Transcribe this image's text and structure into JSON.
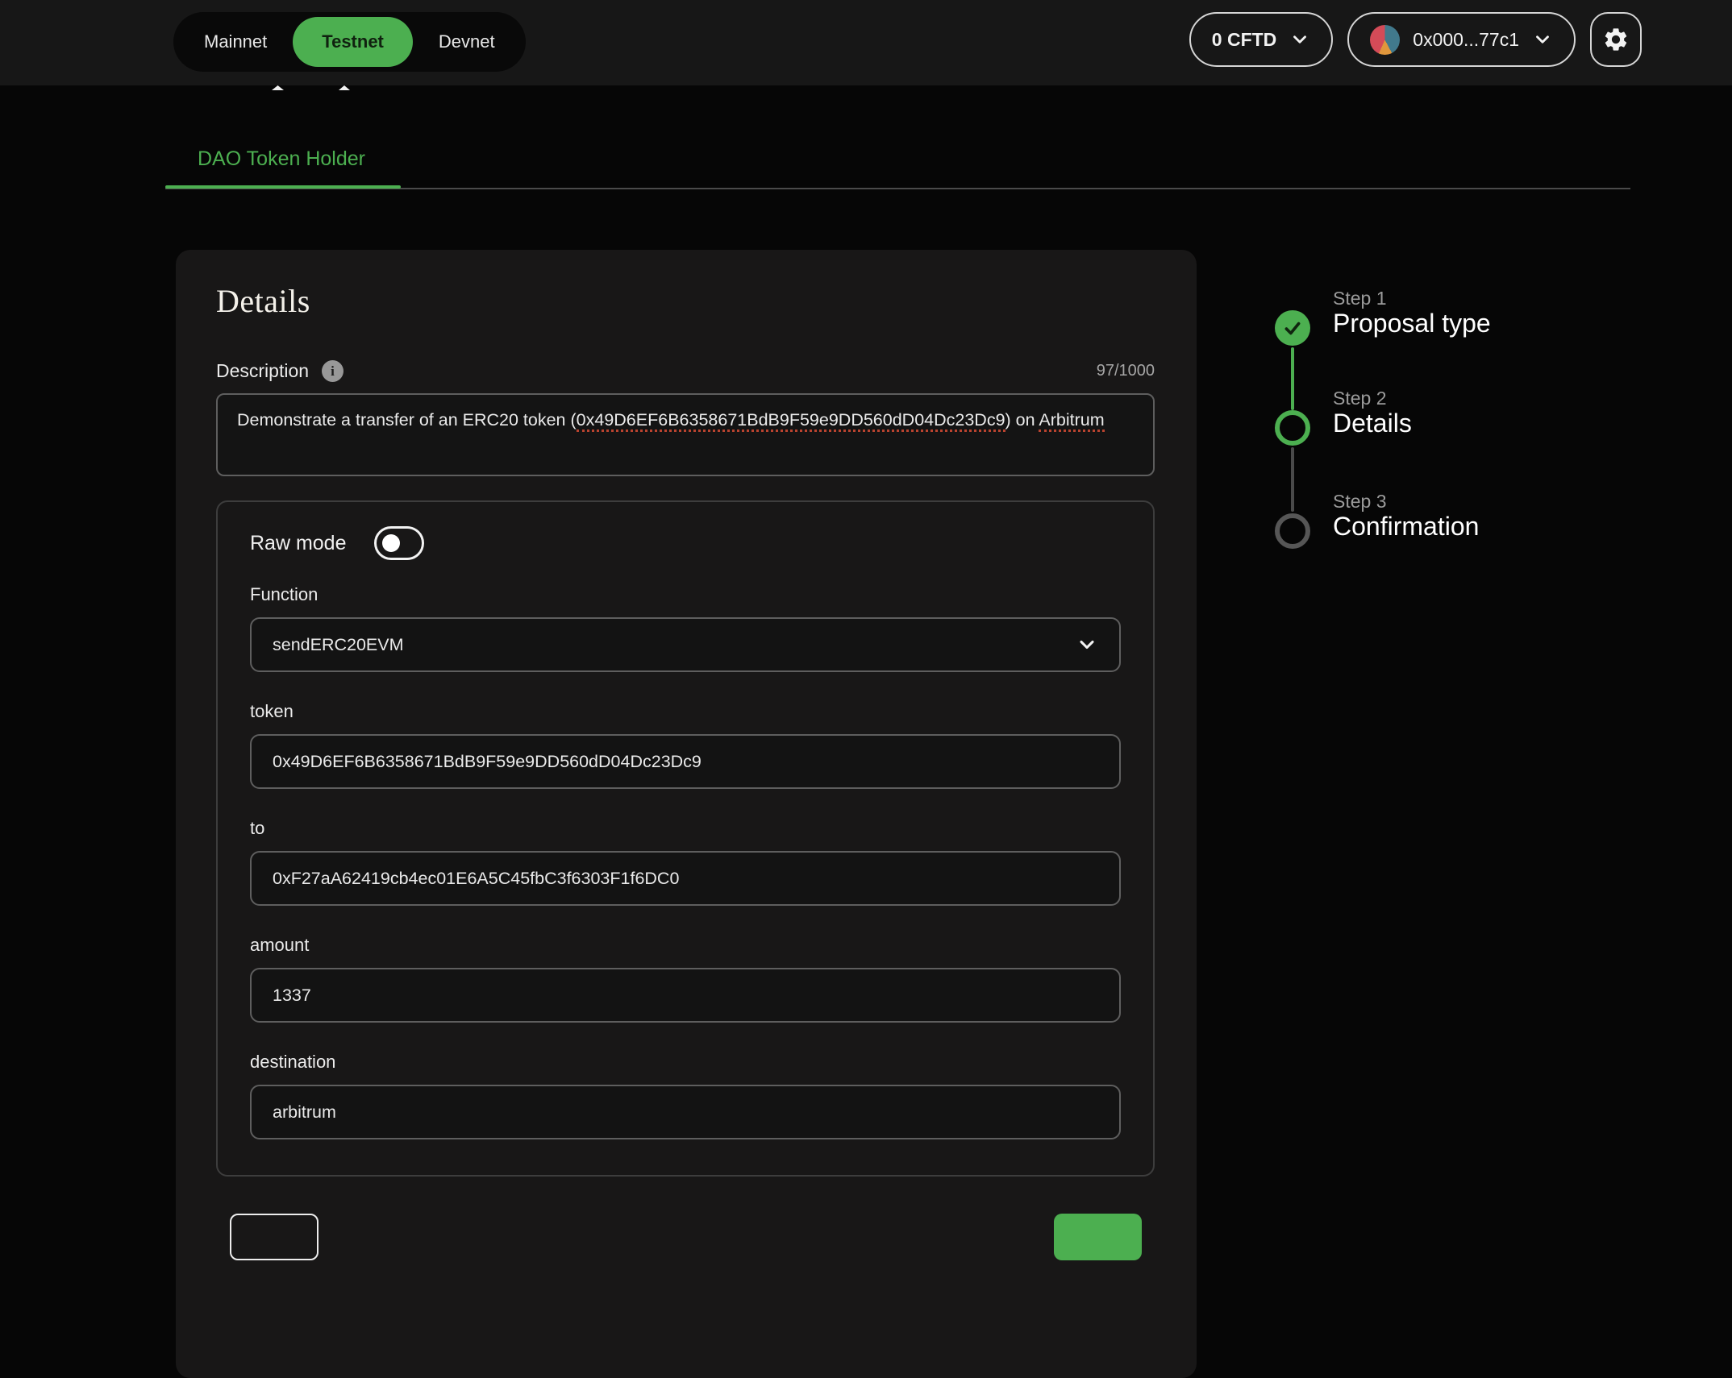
{
  "header": {
    "networks": [
      {
        "label": "Mainnet",
        "active": false
      },
      {
        "label": "Testnet",
        "active": true
      },
      {
        "label": "Devnet",
        "active": false
      }
    ],
    "balance_label": "0 CFTD",
    "wallet_address": "0x000...77c1",
    "settings_icon": "gear-icon",
    "icons": {
      "dropdown": "chevron-down-icon",
      "info_glyph": "i"
    }
  },
  "tabs": {
    "active_tab": "DAO Token Holder"
  },
  "details_card": {
    "title": "Details",
    "description": {
      "label": "Description",
      "counter": "97/1000",
      "value_parts": {
        "pre": "Demonstrate a transfer of an ERC20 token (",
        "address": "0x49D6EF6B6358671BdB9F59e9DD560dD04Dc23Dc9",
        "mid": ") on ",
        "chain": "Arbitrum"
      }
    },
    "form": {
      "raw_mode_label": "Raw mode",
      "raw_mode_on": false,
      "function_label": "Function",
      "function_value": "sendERC20EVM",
      "fields": [
        {
          "label": "token",
          "value": "0x49D6EF6B6358671BdB9F59e9DD560dD04Dc23Dc9"
        },
        {
          "label": "to",
          "value": "0xF27aA62419cb4ec01E6A5C45fbC3f6303F1f6DC0"
        },
        {
          "label": "amount",
          "value": "1337"
        },
        {
          "label": "destination",
          "value": "arbitrum"
        }
      ]
    }
  },
  "stepper": {
    "steps": [
      {
        "label": "Step 1",
        "title": "Proposal type",
        "state": "complete"
      },
      {
        "label": "Step 2",
        "title": "Details",
        "state": "current"
      },
      {
        "label": "Step 3",
        "title": "Confirmation",
        "state": "upcoming"
      }
    ]
  },
  "colors": {
    "accent_green": "#4caf50",
    "spellcheck_red": "#b9432f",
    "page_bg": "#060606",
    "topbar_bg": "#171717",
    "card_bg": "#181717"
  }
}
